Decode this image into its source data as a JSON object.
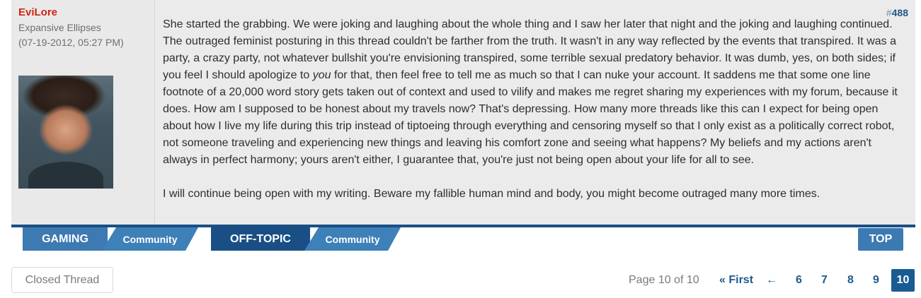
{
  "post": {
    "username": "EviLore",
    "user_title": "Expansive Ellipses",
    "date": "(07-19-2012, 05:27 PM)",
    "post_number_hash": "#",
    "post_number": "488",
    "paragraph1_before": "She started the grabbing. We were joking and laughing about the whole thing and I saw her later that night and the joking and laughing continued. The outraged feminist posturing in this thread couldn't be farther from the truth. It wasn't in any way reflected by the events that transpired. It was a party, a crazy party, not whatever bullshit you're envisioning transpired, some terrible sexual predatory behavior. It was dumb, yes, on both sides; if you feel I should apologize to ",
    "paragraph1_em": "you",
    "paragraph1_after": " for that, then feel free to tell me as much so that I can nuke your account. It saddens me that some one line footnote of a 20,000 word story gets taken out of context and used to vilify and makes me regret sharing my experiences with my forum, because it does. How am I supposed to be honest about my travels now? That's depressing. How many more threads like this can I expect for being open about how I live my life during this trip instead of tiptoeing through everything and censoring myself so that I only exist as a politically correct robot, not someone traveling and experiencing new things and leaving his comfort zone and seeing what happens? My beliefs and my actions aren't always in perfect harmony; yours aren't either, I guarantee that, you're just not being open about your life for all to see.",
    "paragraph2": "I will continue being open with my writing. Beware my fallible human mind and body, you might become outraged many more times."
  },
  "nav": {
    "gaming": "GAMING",
    "gaming_community": "Community",
    "offtopic": "OFF-TOPIC",
    "offtopic_community": "Community",
    "top": "TOP"
  },
  "thread_status": "Closed Thread",
  "pagination": {
    "label": "Page 10 of 10",
    "first": "« First",
    "prev_arrow": "←",
    "pages": [
      "6",
      "7",
      "8",
      "9",
      "10"
    ],
    "current": "10"
  },
  "colors": {
    "username": "#d12414",
    "accent": "#1a4f86",
    "tab": "#3d7ab2"
  }
}
